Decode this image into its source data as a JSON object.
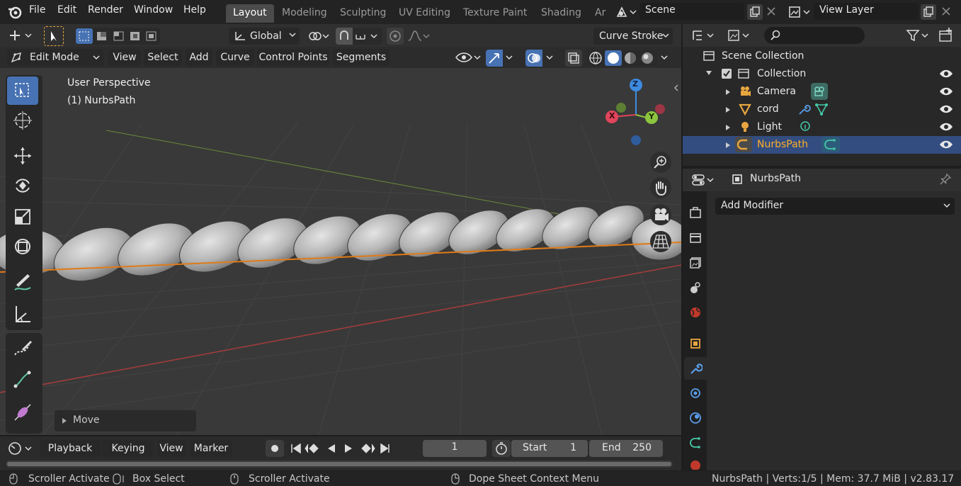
{
  "menu": {
    "file": "File",
    "edit": "Edit",
    "render": "Render",
    "window": "Window",
    "help": "Help"
  },
  "workspaces": [
    "Layout",
    "Modeling",
    "Sculpting",
    "UV Editing",
    "Texture Paint",
    "Shading",
    "Ar"
  ],
  "scene": {
    "name": "Scene",
    "view_layer": "View Layer"
  },
  "viewport": {
    "transform_orientation": "Global",
    "stroke_mode": "Curve Stroke",
    "mode": "Edit Mode",
    "menus": [
      "View",
      "Select",
      "Add",
      "Curve",
      "Control Points",
      "Segments"
    ],
    "info_line1": "User Perspective",
    "info_line2": "(1) NurbsPath",
    "last_op": "Move",
    "gizmo": {
      "x": "X",
      "y": "Y",
      "z": "Z"
    }
  },
  "outliner": {
    "root": "Scene Collection",
    "collection": "Collection",
    "items": [
      {
        "label": "Camera"
      },
      {
        "label": "cord"
      },
      {
        "label": "Light"
      },
      {
        "label": "NurbsPath"
      }
    ]
  },
  "properties": {
    "object_name": "NurbsPath",
    "add_modifier": "Add Modifier"
  },
  "timeline": {
    "playback": "Playback",
    "keying": "Keying",
    "view": "View",
    "marker": "Marker",
    "current_frame": "1",
    "start_label": "Start",
    "start": "1",
    "end_label": "End",
    "end": "250"
  },
  "statusbar": {
    "scroller1": "Scroller Activate",
    "box_select": "Box Select",
    "scroller2": "Scroller Activate",
    "dope_sheet": "Dope Sheet Context Menu",
    "stats": "NurbsPath | Verts:1/5 | Mem: 37.7 MiB | v2.83.17"
  },
  "colors": {
    "accent": "#4772b3",
    "selected_row": "#334d80",
    "selected_text": "#ffaf29",
    "curve_line": "#e07b18",
    "x_axis": "#a63c3c",
    "y_axis": "#6a8a3a"
  }
}
